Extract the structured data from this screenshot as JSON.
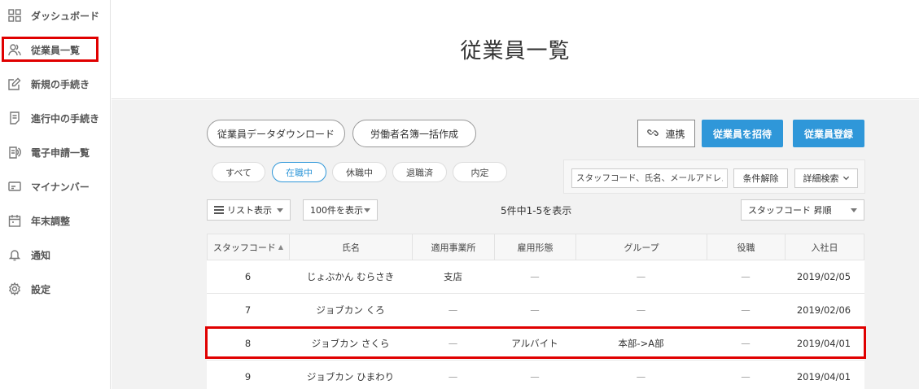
{
  "sidebar": {
    "items": [
      {
        "label": "ダッシュボード",
        "icon": "grid-icon"
      },
      {
        "label": "従業員一覧",
        "icon": "users-icon"
      },
      {
        "label": "新規の手続き",
        "icon": "edit-icon"
      },
      {
        "label": "進行中の手続き",
        "icon": "document-icon"
      },
      {
        "label": "電子申請一覧",
        "icon": "e-application-icon"
      },
      {
        "label": "マイナンバー",
        "icon": "id-card-icon"
      },
      {
        "label": "年末調整",
        "icon": "calendar-icon"
      },
      {
        "label": "通知",
        "icon": "bell-icon"
      },
      {
        "label": "設定",
        "icon": "gear-icon"
      }
    ]
  },
  "header": {
    "title": "従業員一覧"
  },
  "actions": {
    "download": "従業員データダウンロード",
    "bulk_register": "労働者名簿一括作成",
    "link": "連携",
    "invite": "従業員を招待",
    "register": "従業員登録"
  },
  "filters": {
    "tabs": [
      {
        "label": "すべて",
        "active": false
      },
      {
        "label": "在職中",
        "active": true
      },
      {
        "label": "休職中",
        "active": false
      },
      {
        "label": "退職済",
        "active": false
      },
      {
        "label": "内定",
        "active": false
      }
    ]
  },
  "search": {
    "placeholder": "スタッフコード、氏名、メールアドレス",
    "clear": "条件解除",
    "advanced": "詳細検索"
  },
  "view": {
    "mode": "リスト表示",
    "per_page": "100件を表示",
    "count": "5件中1-5を表示",
    "sort": "スタッフコード 昇順"
  },
  "table": {
    "columns": [
      "スタッフコード",
      "氏名",
      "適用事業所",
      "雇用形態",
      "グループ",
      "役職",
      "入社日"
    ],
    "rows": [
      [
        "6",
        "じょぶかん むらさき",
        "支店",
        "—",
        "—",
        "—",
        "2019/02/05"
      ],
      [
        "7",
        "ジョブカン くろ",
        "—",
        "—",
        "—",
        "—",
        "2019/02/06"
      ],
      [
        "8",
        "ジョブカン さくら",
        "—",
        "アルバイト",
        "本部->A部",
        "—",
        "2019/04/01"
      ],
      [
        "9",
        "ジョブカン ひまわり",
        "—",
        "—",
        "—",
        "—",
        "2019/04/01"
      ]
    ]
  },
  "colors": {
    "accent": "#2f97d9",
    "highlight": "#e00000"
  }
}
